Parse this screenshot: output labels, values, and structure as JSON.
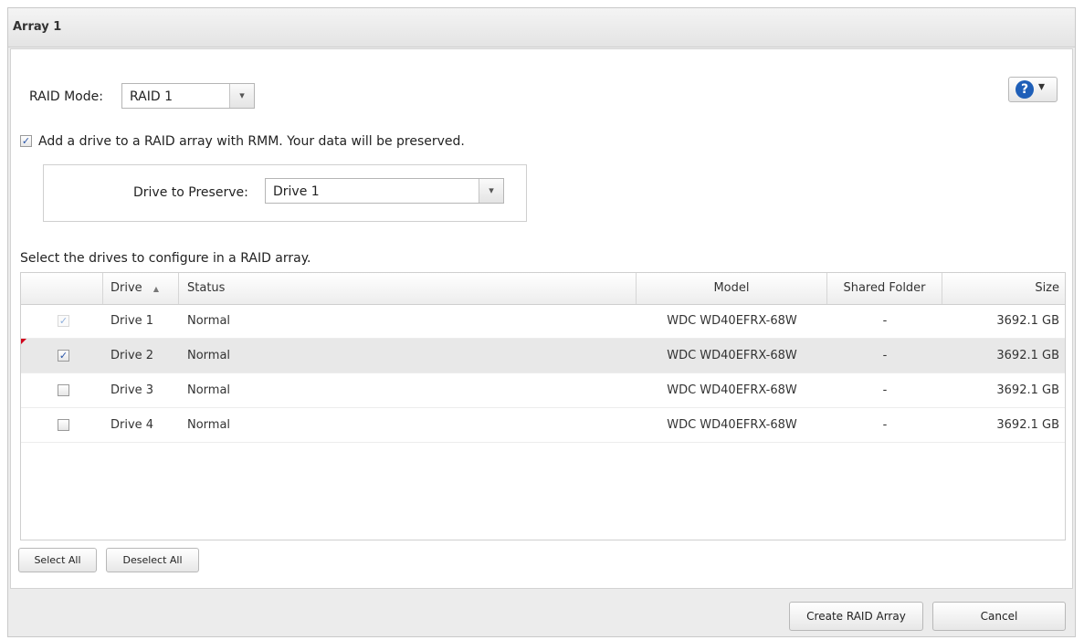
{
  "window": {
    "title": "Array 1"
  },
  "raid_mode": {
    "label": "RAID Mode:",
    "value": "RAID 1"
  },
  "rmm": {
    "label": "Add a drive to a RAID array with RMM. Your data will be preserved.",
    "checked": true
  },
  "preserve": {
    "label": "Drive to Preserve:",
    "value": "Drive 1"
  },
  "instruction": "Select the drives to configure in a RAID array.",
  "grid": {
    "columns": {
      "drive": "Drive",
      "sort_indicator": "▲",
      "status": "Status",
      "model": "Model",
      "shared_folder": "Shared Folder",
      "size": "Size"
    },
    "rows": [
      {
        "drive": "Drive 1",
        "status": "Normal",
        "model": "WDC WD40EFRX-68W",
        "shared_folder": "-",
        "size": "3692.1 GB",
        "check": "✓"
      },
      {
        "drive": "Drive 2",
        "status": "Normal",
        "model": "WDC WD40EFRX-68W",
        "shared_folder": "-",
        "size": "3692.1 GB",
        "check": "✓"
      },
      {
        "drive": "Drive 3",
        "status": "Normal",
        "model": "WDC WD40EFRX-68W",
        "shared_folder": "-",
        "size": "3692.1 GB",
        "check": ""
      },
      {
        "drive": "Drive 4",
        "status": "Normal",
        "model": "WDC WD40EFRX-68W",
        "shared_folder": "-",
        "size": "3692.1 GB",
        "check": ""
      }
    ]
  },
  "buttons": {
    "select_all": "Select All",
    "deselect_all": "Deselect All",
    "create": "Create RAID Array",
    "cancel": "Cancel"
  },
  "help": {
    "glyph": "?",
    "caret": "▾"
  },
  "icons": {
    "dropdown": "▾",
    "check": "✓"
  }
}
